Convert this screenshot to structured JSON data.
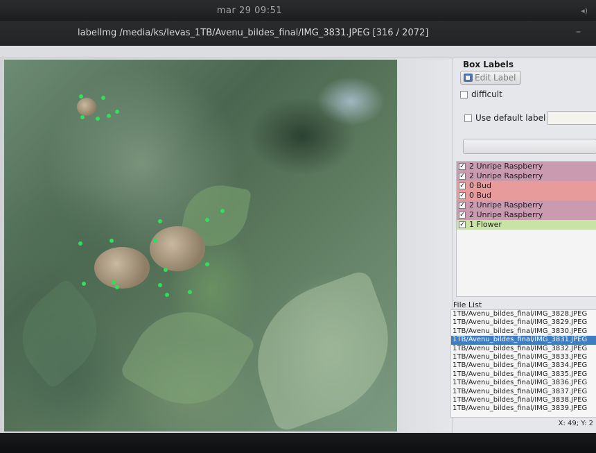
{
  "system": {
    "clock": "mar 29 09:51"
  },
  "window": {
    "title": "labelImg /media/ks/Ievas_1TB/Avenu_bildes_final/IMG_3831.JPEG [316 / 2072]"
  },
  "dock": {
    "title": "Box Labels",
    "edit_label_button": "Edit Label",
    "difficult_label": "difficult",
    "use_default_label": "Use default label",
    "default_label_value": "",
    "labels": [
      {
        "text": "2 Unripe Raspberry",
        "checked": true,
        "color": "#c99ab0"
      },
      {
        "text": "2 Unripe Raspberry",
        "checked": true,
        "color": "#c99ab0"
      },
      {
        "text": "0 Bud",
        "checked": true,
        "color": "#e79b9a"
      },
      {
        "text": "0 Bud",
        "checked": true,
        "color": "#e79b9a"
      },
      {
        "text": "2 Unripe Raspberry",
        "checked": true,
        "color": "#c99ab0"
      },
      {
        "text": "2 Unripe Raspberry",
        "checked": true,
        "color": "#c99ab0"
      },
      {
        "text": "1 Flower",
        "checked": true,
        "color": "#c9e2a6"
      }
    ],
    "file_list_title": "File List",
    "files": [
      "1TB/Avenu_bildes_final/IMG_3828.JPEG",
      "1TB/Avenu_bildes_final/IMG_3829.JPEG",
      "1TB/Avenu_bildes_final/IMG_3830.JPEG",
      "1TB/Avenu_bildes_final/IMG_3831.JPEG",
      "1TB/Avenu_bildes_final/IMG_3832.JPEG",
      "1TB/Avenu_bildes_final/IMG_3833.JPEG",
      "1TB/Avenu_bildes_final/IMG_3834.JPEG",
      "1TB/Avenu_bildes_final/IMG_3835.JPEG",
      "1TB/Avenu_bildes_final/IMG_3836.JPEG",
      "1TB/Avenu_bildes_final/IMG_3837.JPEG",
      "1TB/Avenu_bildes_final/IMG_3838.JPEG",
      "1TB/Avenu_bildes_final/IMG_3839.JPEG"
    ],
    "selected_file_index": 3,
    "status": "X: 49; Y: 2"
  },
  "icons": {
    "edit_label": "pencil-icon",
    "volume": "speaker-icon",
    "minimize": "minimize-icon"
  }
}
